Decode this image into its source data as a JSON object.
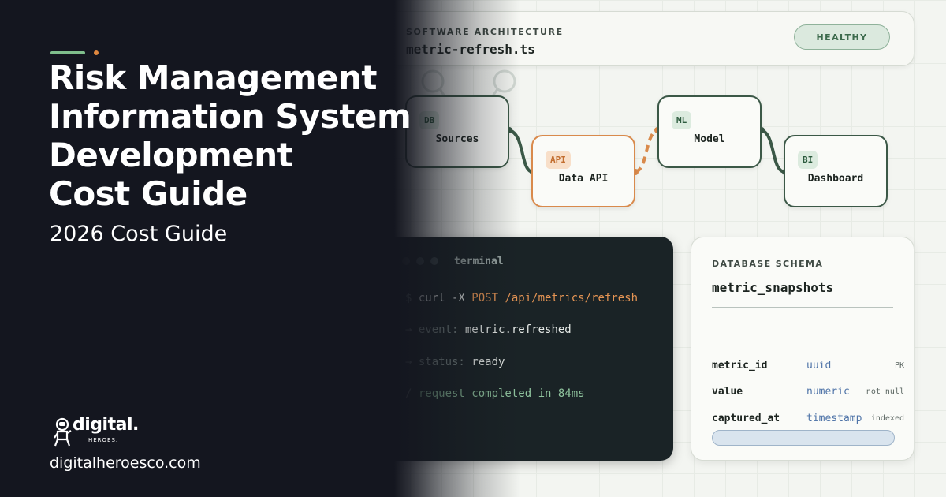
{
  "headline": {
    "accent_color": "#7fbe8c",
    "lines": [
      "Risk Management",
      "Information System",
      "Development",
      "Cost Guide"
    ],
    "subtitle": "2026 Cost Guide"
  },
  "brand": {
    "name": "digital.",
    "tagline": "HEROES.",
    "logo_icon": "astronaut-icon",
    "url": "digitalheroesco.com"
  },
  "architecture": {
    "kicker": "SOFTWARE ARCHITECTURE",
    "file": "metric-refresh.ts",
    "status": "HEALTHY",
    "status_color": "#3d6b4d",
    "nodes": [
      {
        "tag": "DB",
        "label": "Sources"
      },
      {
        "tag": "API",
        "label": "Data API"
      },
      {
        "tag": "ML",
        "label": "Model"
      },
      {
        "tag": "BI",
        "label": "Dashboard"
      }
    ]
  },
  "terminal": {
    "title": "terminal",
    "lines": [
      {
        "prefix": "$",
        "parts": [
          {
            "text": "curl -X ",
            "tone": "plain"
          },
          {
            "text": "POST /api/metrics/refresh",
            "tone": "orange"
          }
        ]
      },
      {
        "prefix": "→",
        "parts": [
          {
            "text": "event: ",
            "tone": "plain"
          },
          {
            "text": "metric.refreshed",
            "tone": "plain"
          }
        ]
      },
      {
        "prefix": "→",
        "parts": [
          {
            "text": "status: ",
            "tone": "plain"
          },
          {
            "text": "ready",
            "tone": "plain"
          }
        ]
      },
      {
        "prefix": "/",
        "parts": [
          {
            "text": "request completed in ",
            "tone": "green"
          },
          {
            "text": "84ms",
            "tone": "green"
          }
        ]
      }
    ]
  },
  "schema": {
    "kicker": "DATABASE SCHEMA",
    "table": "metric_snapshots",
    "fields": [
      {
        "name": "metric_id",
        "type": "uuid",
        "note": "PK"
      },
      {
        "name": "value",
        "type": "numeric",
        "note": "not null"
      },
      {
        "name": "captured_at",
        "type": "timestamp",
        "note": "indexed"
      }
    ]
  }
}
